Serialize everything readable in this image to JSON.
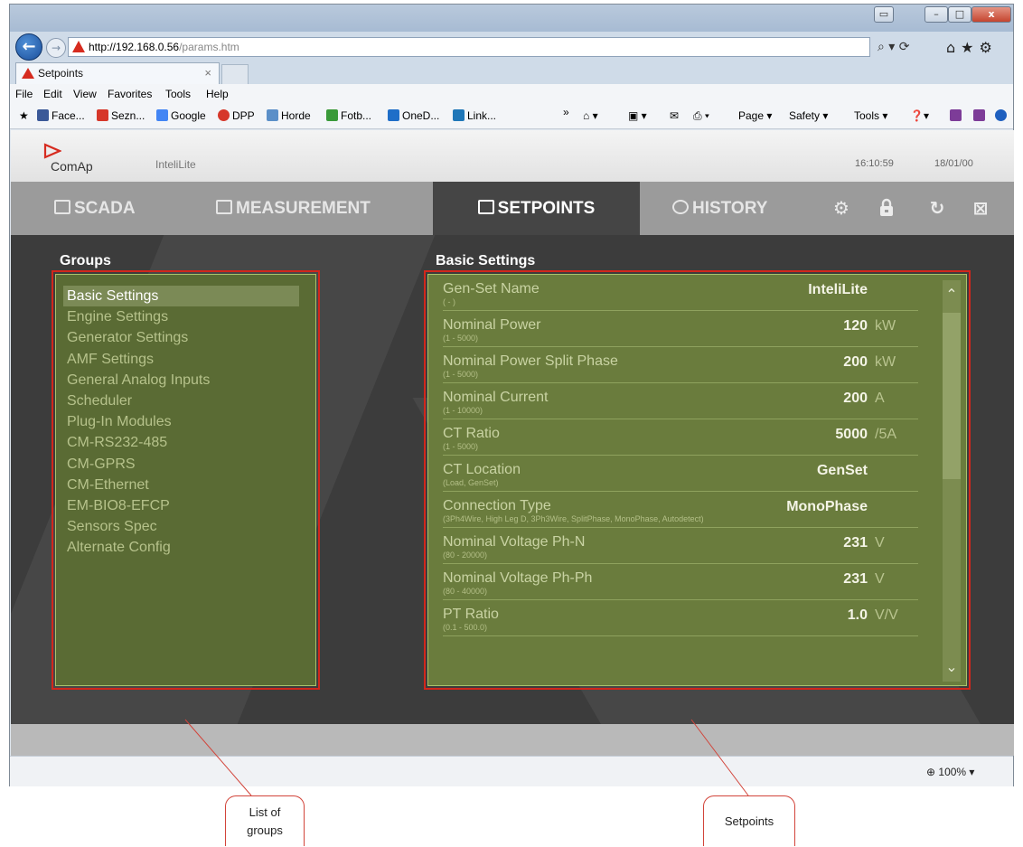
{
  "browser": {
    "address": {
      "host": "http://192.168.0.56",
      "path": "/params.htm"
    },
    "tab": {
      "title": "Setpoints",
      "close": "×"
    },
    "window_buttons": {
      "compat": "▭",
      "minimize": "–",
      "maximize": "□",
      "close": "x"
    },
    "address_tools": "⌕ ▾ ⟳",
    "right_icons": "⌂★⚙",
    "menu": [
      "File",
      "Edit",
      "View",
      "Favorites",
      "Tools",
      "Help"
    ],
    "favorites": [
      {
        "label": "Face...",
        "color": "#3b5998"
      },
      {
        "label": "Sezn...",
        "color": "#d6372a"
      },
      {
        "label": "Google",
        "color": "#4285f4"
      },
      {
        "label": "DPP",
        "color": "#d6372a"
      },
      {
        "label": "Horde",
        "color": "#5b8fc8"
      },
      {
        "label": "Fotb...",
        "color": "#3a9a3a"
      },
      {
        "label": "OneD...",
        "color": "#1e6ec8"
      },
      {
        "label": "Link...",
        "color": "#1f77b8"
      }
    ],
    "fav_more": "»",
    "command_bar": [
      "Page ▾",
      "Safety ▾",
      "Tools ▾"
    ],
    "zoom": "100%"
  },
  "app": {
    "logo": "ComAp",
    "device": "InteliLite",
    "time": "16:10:59",
    "date": "18/01/00",
    "nav": {
      "scada": "SCADA",
      "measurement": "MEASUREMENT",
      "setpoints": "SETPOINTS",
      "history": "HISTORY"
    },
    "nav_icons": {
      "gear": "⚙",
      "lock": "🔒",
      "refresh": "↻",
      "close": "⊠"
    },
    "groups_title": "Groups",
    "groups": [
      "Basic Settings",
      "Engine Settings",
      "Generator Settings",
      "AMF Settings",
      "General Analog Inputs",
      "Scheduler",
      "Plug-In Modules",
      "CM-RS232-485",
      "CM-GPRS",
      "CM-Ethernet",
      "EM-BIO8-EFCP",
      "Sensors Spec",
      "Alternate Config"
    ],
    "selected_group": "Basic Settings",
    "setpoints_title": "Basic Settings",
    "scroll": {
      "up": "⌃",
      "down": "⌄"
    },
    "setpoints": [
      {
        "name": "Gen-Set Name",
        "range": "( - )",
        "value": "InteliLite",
        "unit": ""
      },
      {
        "name": "Nominal Power",
        "range": "(1 - 5000)",
        "value": "120",
        "unit": "kW"
      },
      {
        "name": "Nominal Power Split Phase",
        "range": "(1 - 5000)",
        "value": "200",
        "unit": "kW"
      },
      {
        "name": "Nominal Current",
        "range": "(1 - 10000)",
        "value": "200",
        "unit": "A"
      },
      {
        "name": "CT Ratio",
        "range": "(1 - 5000)",
        "value": "5000",
        "unit": "/5A"
      },
      {
        "name": "CT Location",
        "range": "(Load, GenSet)",
        "value": "GenSet",
        "unit": ""
      },
      {
        "name": "Connection Type",
        "range": "(3Ph4Wire, High Leg D, 3Ph3Wire, SplitPhase, MonoPhase, Autodetect)",
        "value": "MonoPhase",
        "unit": ""
      },
      {
        "name": "Nominal Voltage Ph-N",
        "range": "(80 - 20000)",
        "value": "231",
        "unit": "V"
      },
      {
        "name": "Nominal Voltage Ph-Ph",
        "range": "(80 - 40000)",
        "value": "231",
        "unit": "V"
      },
      {
        "name": "PT Ratio",
        "range": "(0.1 - 500.0)",
        "value": "1.0",
        "unit": "V/V"
      }
    ]
  },
  "annotations": {
    "groups_line1": "List of",
    "groups_line2": "groups",
    "setpoints": "Setpoints"
  },
  "colors": {
    "accent_red": "#d2261b",
    "panel_green": "#6a7c3d",
    "nav_active": "#454545"
  }
}
